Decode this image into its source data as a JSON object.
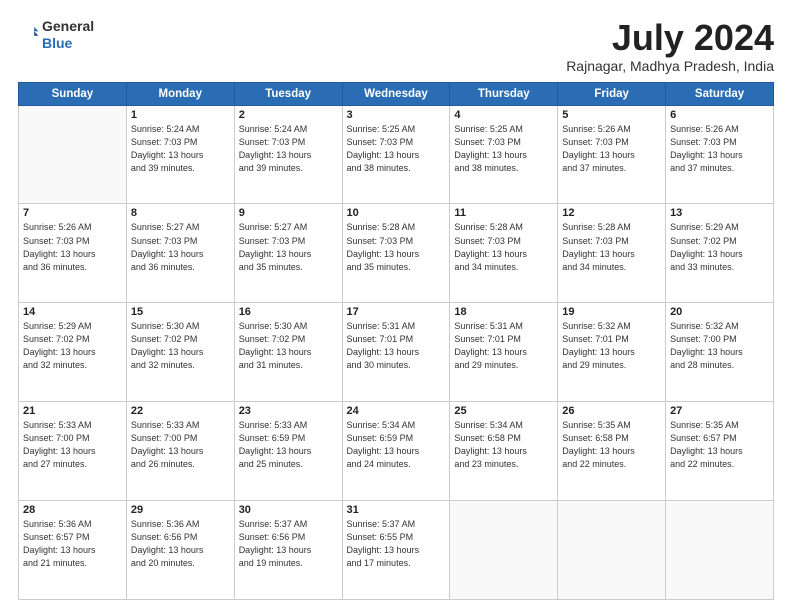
{
  "header": {
    "logo_line1": "General",
    "logo_line2": "Blue",
    "month_title": "July 2024",
    "location": "Rajnagar, Madhya Pradesh, India"
  },
  "weekdays": [
    "Sunday",
    "Monday",
    "Tuesday",
    "Wednesday",
    "Thursday",
    "Friday",
    "Saturday"
  ],
  "weeks": [
    [
      {
        "day": "",
        "info": ""
      },
      {
        "day": "1",
        "info": "Sunrise: 5:24 AM\nSunset: 7:03 PM\nDaylight: 13 hours\nand 39 minutes."
      },
      {
        "day": "2",
        "info": "Sunrise: 5:24 AM\nSunset: 7:03 PM\nDaylight: 13 hours\nand 39 minutes."
      },
      {
        "day": "3",
        "info": "Sunrise: 5:25 AM\nSunset: 7:03 PM\nDaylight: 13 hours\nand 38 minutes."
      },
      {
        "day": "4",
        "info": "Sunrise: 5:25 AM\nSunset: 7:03 PM\nDaylight: 13 hours\nand 38 minutes."
      },
      {
        "day": "5",
        "info": "Sunrise: 5:26 AM\nSunset: 7:03 PM\nDaylight: 13 hours\nand 37 minutes."
      },
      {
        "day": "6",
        "info": "Sunrise: 5:26 AM\nSunset: 7:03 PM\nDaylight: 13 hours\nand 37 minutes."
      }
    ],
    [
      {
        "day": "7",
        "info": "Sunrise: 5:26 AM\nSunset: 7:03 PM\nDaylight: 13 hours\nand 36 minutes."
      },
      {
        "day": "8",
        "info": "Sunrise: 5:27 AM\nSunset: 7:03 PM\nDaylight: 13 hours\nand 36 minutes."
      },
      {
        "day": "9",
        "info": "Sunrise: 5:27 AM\nSunset: 7:03 PM\nDaylight: 13 hours\nand 35 minutes."
      },
      {
        "day": "10",
        "info": "Sunrise: 5:28 AM\nSunset: 7:03 PM\nDaylight: 13 hours\nand 35 minutes."
      },
      {
        "day": "11",
        "info": "Sunrise: 5:28 AM\nSunset: 7:03 PM\nDaylight: 13 hours\nand 34 minutes."
      },
      {
        "day": "12",
        "info": "Sunrise: 5:28 AM\nSunset: 7:03 PM\nDaylight: 13 hours\nand 34 minutes."
      },
      {
        "day": "13",
        "info": "Sunrise: 5:29 AM\nSunset: 7:02 PM\nDaylight: 13 hours\nand 33 minutes."
      }
    ],
    [
      {
        "day": "14",
        "info": "Sunrise: 5:29 AM\nSunset: 7:02 PM\nDaylight: 13 hours\nand 32 minutes."
      },
      {
        "day": "15",
        "info": "Sunrise: 5:30 AM\nSunset: 7:02 PM\nDaylight: 13 hours\nand 32 minutes."
      },
      {
        "day": "16",
        "info": "Sunrise: 5:30 AM\nSunset: 7:02 PM\nDaylight: 13 hours\nand 31 minutes."
      },
      {
        "day": "17",
        "info": "Sunrise: 5:31 AM\nSunset: 7:01 PM\nDaylight: 13 hours\nand 30 minutes."
      },
      {
        "day": "18",
        "info": "Sunrise: 5:31 AM\nSunset: 7:01 PM\nDaylight: 13 hours\nand 29 minutes."
      },
      {
        "day": "19",
        "info": "Sunrise: 5:32 AM\nSunset: 7:01 PM\nDaylight: 13 hours\nand 29 minutes."
      },
      {
        "day": "20",
        "info": "Sunrise: 5:32 AM\nSunset: 7:00 PM\nDaylight: 13 hours\nand 28 minutes."
      }
    ],
    [
      {
        "day": "21",
        "info": "Sunrise: 5:33 AM\nSunset: 7:00 PM\nDaylight: 13 hours\nand 27 minutes."
      },
      {
        "day": "22",
        "info": "Sunrise: 5:33 AM\nSunset: 7:00 PM\nDaylight: 13 hours\nand 26 minutes."
      },
      {
        "day": "23",
        "info": "Sunrise: 5:33 AM\nSunset: 6:59 PM\nDaylight: 13 hours\nand 25 minutes."
      },
      {
        "day": "24",
        "info": "Sunrise: 5:34 AM\nSunset: 6:59 PM\nDaylight: 13 hours\nand 24 minutes."
      },
      {
        "day": "25",
        "info": "Sunrise: 5:34 AM\nSunset: 6:58 PM\nDaylight: 13 hours\nand 23 minutes."
      },
      {
        "day": "26",
        "info": "Sunrise: 5:35 AM\nSunset: 6:58 PM\nDaylight: 13 hours\nand 22 minutes."
      },
      {
        "day": "27",
        "info": "Sunrise: 5:35 AM\nSunset: 6:57 PM\nDaylight: 13 hours\nand 22 minutes."
      }
    ],
    [
      {
        "day": "28",
        "info": "Sunrise: 5:36 AM\nSunset: 6:57 PM\nDaylight: 13 hours\nand 21 minutes."
      },
      {
        "day": "29",
        "info": "Sunrise: 5:36 AM\nSunset: 6:56 PM\nDaylight: 13 hours\nand 20 minutes."
      },
      {
        "day": "30",
        "info": "Sunrise: 5:37 AM\nSunset: 6:56 PM\nDaylight: 13 hours\nand 19 minutes."
      },
      {
        "day": "31",
        "info": "Sunrise: 5:37 AM\nSunset: 6:55 PM\nDaylight: 13 hours\nand 17 minutes."
      },
      {
        "day": "",
        "info": ""
      },
      {
        "day": "",
        "info": ""
      },
      {
        "day": "",
        "info": ""
      }
    ]
  ]
}
